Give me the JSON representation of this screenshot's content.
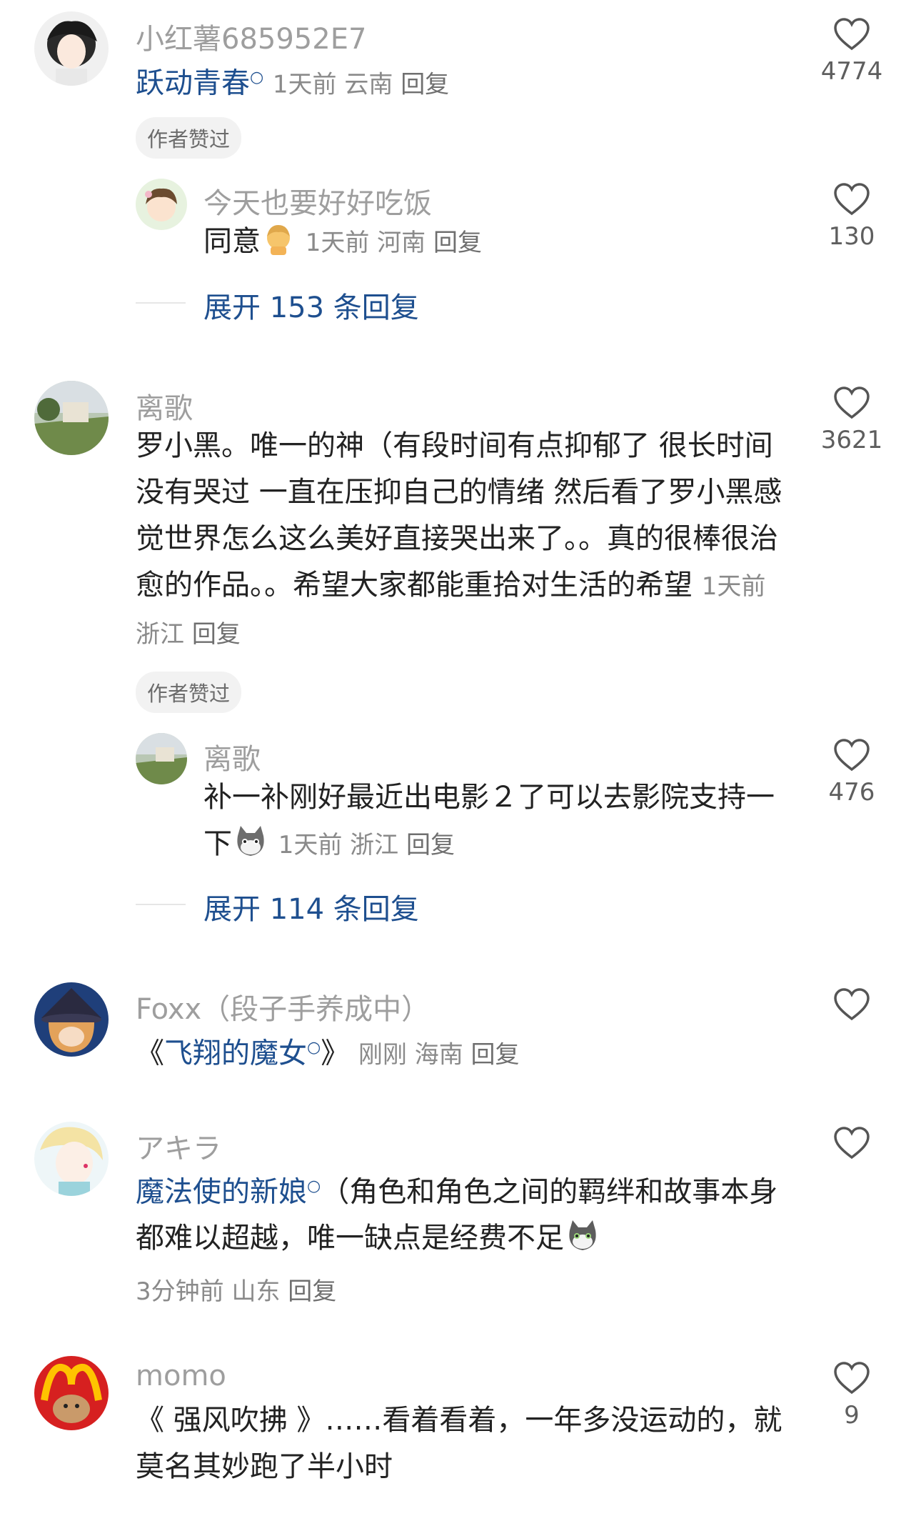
{
  "comments": [
    {
      "name": "小红薯685952E7",
      "text_link": "跃动青春",
      "time": "1天前",
      "loc": "云南",
      "reply": "回复",
      "badge": "作者赞过",
      "likes": "4774",
      "sub": {
        "name": "今天也要好好吃饭",
        "text": "同意",
        "time": "1天前",
        "loc": "河南",
        "reply": "回复",
        "likes": "130"
      },
      "expand": "展开 153 条回复"
    },
    {
      "name": "离歌",
      "text": "罗小黑。唯一的神（有段时间有点抑郁了 很长时间没有哭过 一直在压抑自己的情绪 然后看了罗小黑感觉世界怎么这么美好直接哭出来了。。真的很棒很治愈的作品。。希望大家都能重拾对生活的希望",
      "time": "1天前",
      "loc": "浙江",
      "reply": "回复",
      "badge": "作者赞过",
      "likes": "3621",
      "sub": {
        "name": "离歌",
        "text": "补一补刚好最近出电影２了可以去影院支持一下",
        "time": "1天前",
        "loc": "浙江",
        "reply": "回复",
        "likes": "476"
      },
      "expand": "展开 114 条回复"
    },
    {
      "name": "Foxx（段子手养成中）",
      "text_open": "《",
      "text_link": "飞翔的魔女",
      "text_close": "》",
      "time": "刚刚",
      "loc": "海南",
      "reply": "回复"
    },
    {
      "name": "アキラ",
      "text_link": "魔法使的新娘",
      "text": "（角色和角色之间的羁绊和故事本身都难以超越，唯一缺点是经费不足",
      "time": "3分钟前",
      "loc": "山东",
      "reply": "回复"
    },
    {
      "name": "momo",
      "text": "《 强风吹拂 》……看着看着，一年多没运动的，就莫名其妙跑了半小时",
      "likes": "9"
    }
  ],
  "icons": {
    "like": "heart-outline-icon",
    "search": "search-tag-icon"
  },
  "colors": {
    "link": "#1e4f8f",
    "muted": "#9e9e9e",
    "text": "#222222"
  }
}
